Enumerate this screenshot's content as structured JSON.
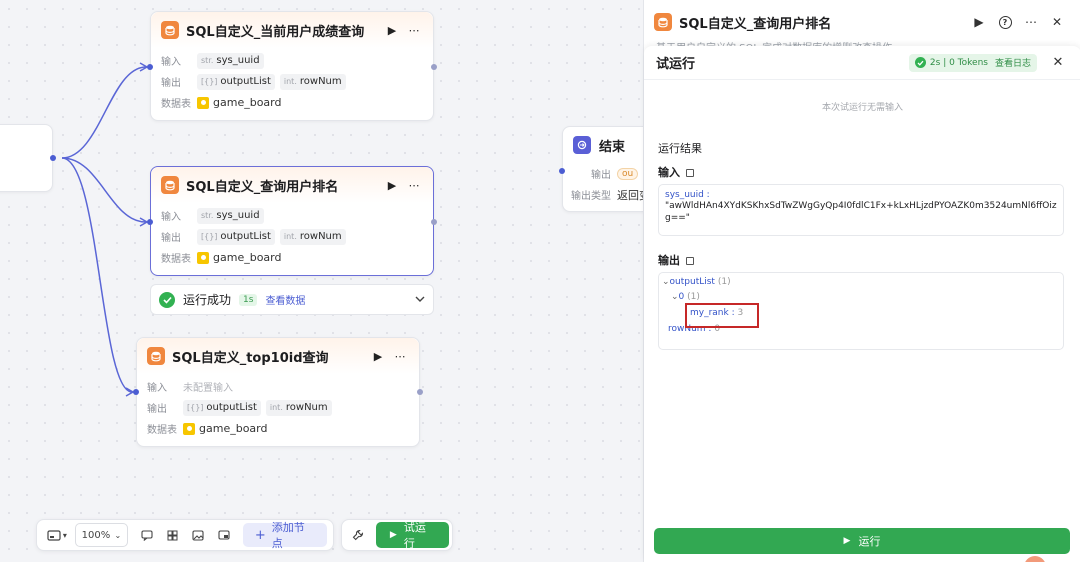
{
  "canvas": {
    "nodes": [
      {
        "title": "SQL自定义_当前用户成绩查询",
        "input_label": "输入",
        "input_type": "str.",
        "input_value": "sys_uuid",
        "output_label": "输出",
        "out1_type": "[{}]",
        "out1": "outputList",
        "out2_type": "int.",
        "out2": "rowNum",
        "table_label": "数据表",
        "table": "game_board"
      },
      {
        "title": "SQL自定义_查询用户排名",
        "input_label": "输入",
        "input_type": "str.",
        "input_value": "sys_uuid",
        "output_label": "输出",
        "out1_type": "[{}]",
        "out1": "outputList",
        "out2_type": "int.",
        "out2": "rowNum",
        "table_label": "数据表",
        "table": "game_board"
      },
      {
        "title": "SQL自定义_top10id查询",
        "input_label": "输入",
        "input_value": "未配置输入",
        "output_label": "输出",
        "out1_type": "[{}]",
        "out1": "outputList",
        "out2_type": "int.",
        "out2": "rowNum",
        "table_label": "数据表",
        "table": "game_board"
      }
    ],
    "success": {
      "text": "运行成功",
      "duration": "1s",
      "link": "查看数据"
    },
    "end_node": {
      "title": "结束",
      "output_label": "输出",
      "output_chip": "ou",
      "type_label": "输出类型",
      "type_value": "返回变"
    }
  },
  "toolbar": {
    "zoom": "100%",
    "add_node": "添加节点",
    "try_run": "试运行"
  },
  "panel": {
    "title": "SQL自定义_查询用户排名",
    "desc_peek": "基于用户自定义的 SQL 完成对数据库的增删改查操作",
    "run": {
      "title": "试运行",
      "stat": "2s | 0 Tokens",
      "log_link": "查看日志",
      "no_input": "本次试运行无需输入",
      "result_label": "运行结果",
      "input_label": "输入",
      "input_key": "sys_uuid :",
      "input_value": "\"awWldHAn4XYdKSKhxSdTwZWgGyQp4I0fdlC1Fx+kLxHLjzdPYOAZK0m3524umNl6ffOizg==\"",
      "output_label": "输出",
      "tree": {
        "root": "outputList",
        "root_count": "(1)",
        "idx": "0",
        "idx_count": "(1)",
        "rank_key": "my_rank :",
        "rank_value": "3",
        "rownum_key": "rowNum :",
        "rownum_value": "0"
      },
      "run_button": "运行"
    }
  },
  "colors": {
    "accent": "#4b5dd2",
    "success": "#32a852",
    "db_icon": "#f0873e",
    "highlight": "#c62828"
  }
}
